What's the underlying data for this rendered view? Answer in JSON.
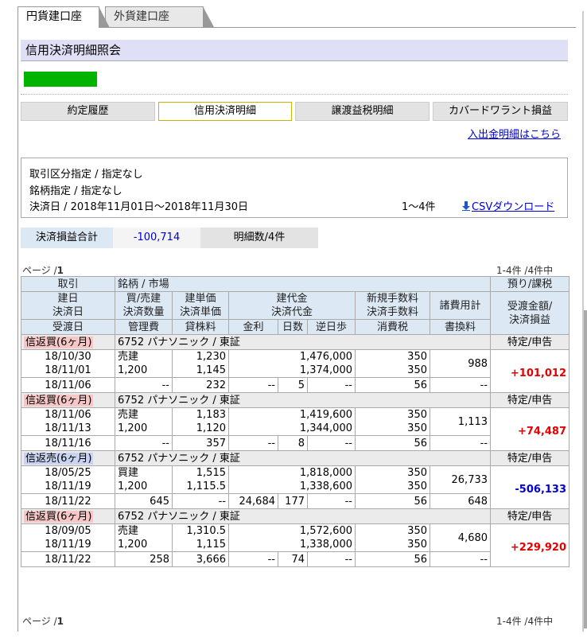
{
  "tabs": {
    "active": "円貨建口座",
    "inactive": "外貨建口座"
  },
  "page_title": "信用決済明細照会",
  "nav": {
    "items": [
      "約定履歴",
      "信用決済明細",
      "譲渡益税明細",
      "カバードワラント損益"
    ],
    "active_index": 1
  },
  "deposit_link": "入出金明細はこちら",
  "conditions": {
    "trade_type": "取引区分指定 / 指定なし",
    "stock": "銘柄指定 /  指定なし",
    "date_range": "決済日 / 2018年11月01日～2018年11月30日",
    "count": "1～4件",
    "csv_label": "CSVダウンロード"
  },
  "summary": {
    "pl_label": "決済損益合計",
    "pl_value": "-100,714",
    "detail_count": "明細数/4件"
  },
  "pager": {
    "page_label": "ページ /",
    "page_num": "1",
    "count_label": "1-4件 /4件中"
  },
  "headers": {
    "row1": {
      "trade": "取引",
      "stock_market": "銘柄 / 市場",
      "custody_tax": "預り/課税"
    },
    "row2": {
      "open_date": "建日",
      "settle_date": "決済日",
      "buy_sell": "買/売建",
      "settle_qty": "決済数量",
      "open_price": "建単価",
      "settle_price": "決済単価",
      "open_amount": "建代金",
      "settle_amount": "決済代金",
      "new_fee": "新規手数料",
      "settle_fee": "決済手数料",
      "misc_fee": "諸費用計",
      "delivery_amount": "受渡金額/",
      "settle_pl": "決済損益"
    },
    "row3": {
      "delivery_date": "受渡日",
      "mgmt_fee": "管理費",
      "lending_fee": "貸株料",
      "interest": "金利",
      "days": "日数",
      "reverse_fee": "逆日歩",
      "consumption_tax": "消費税",
      "rewrite_fee": "書換料"
    }
  },
  "trades": [
    {
      "type": "信返買(6ヶ月)",
      "side": "buy",
      "stock": "6752 パナソニック / 東証",
      "tax": "特定/申告",
      "open_date": "18/10/30",
      "settle_date": "18/11/01",
      "direction": "売建",
      "qty": "1,200",
      "open_price": "1,230",
      "settle_price": "1,145",
      "open_amount": "1,476,000",
      "settle_amount": "1,374,000",
      "new_fee": "350",
      "settle_fee": "350",
      "misc": "988",
      "pl": "+101,012",
      "delivery_date": "18/11/06",
      "mgmt": "--",
      "lend": "232",
      "interest": "--",
      "days": "5",
      "reverse": "--",
      "ctax": "56",
      "rewrite": "--"
    },
    {
      "type": "信返買(6ヶ月)",
      "side": "buy",
      "stock": "6752 パナソニック / 東証",
      "tax": "特定/申告",
      "open_date": "18/11/06",
      "settle_date": "18/11/13",
      "direction": "売建",
      "qty": "1,200",
      "open_price": "1,183",
      "settle_price": "1,120",
      "open_amount": "1,419,600",
      "settle_amount": "1,344,000",
      "new_fee": "350",
      "settle_fee": "350",
      "misc": "1,113",
      "pl": "+74,487",
      "delivery_date": "18/11/16",
      "mgmt": "--",
      "lend": "357",
      "interest": "--",
      "days": "8",
      "reverse": "--",
      "ctax": "56",
      "rewrite": "--"
    },
    {
      "type": "信返売(6ヶ月)",
      "side": "sell",
      "stock": "6752 パナソニック / 東証",
      "tax": "特定/申告",
      "open_date": "18/05/25",
      "settle_date": "18/11/19",
      "direction": "買建",
      "qty": "1,200",
      "open_price": "1,515",
      "settle_price": "1,115.5",
      "open_amount": "1,818,000",
      "settle_amount": "1,338,600",
      "new_fee": "350",
      "settle_fee": "350",
      "misc": "26,733",
      "pl": "-506,133",
      "delivery_date": "18/11/22",
      "mgmt": "645",
      "lend": "--",
      "interest": "24,684",
      "days": "177",
      "reverse": "--",
      "ctax": "56",
      "rewrite": "648"
    },
    {
      "type": "信返買(6ヶ月)",
      "side": "buy",
      "stock": "6752 パナソニック / 東証",
      "tax": "特定/申告",
      "open_date": "18/09/05",
      "settle_date": "18/11/19",
      "direction": "売建",
      "qty": "1,200",
      "open_price": "1,310.5",
      "settle_price": "1,115",
      "open_amount": "1,572,600",
      "settle_amount": "1,338,000",
      "new_fee": "350",
      "settle_fee": "350",
      "misc": "4,680",
      "pl": "+229,920",
      "delivery_date": "18/11/22",
      "mgmt": "258",
      "lend": "3,666",
      "interest": "--",
      "days": "74",
      "reverse": "--",
      "ctax": "56",
      "rewrite": "--"
    }
  ],
  "colors": {
    "title_bg": "#dfe0f5",
    "header_bg": "#dde8f5",
    "positive": "#e60000",
    "negative": "#0000d0"
  }
}
